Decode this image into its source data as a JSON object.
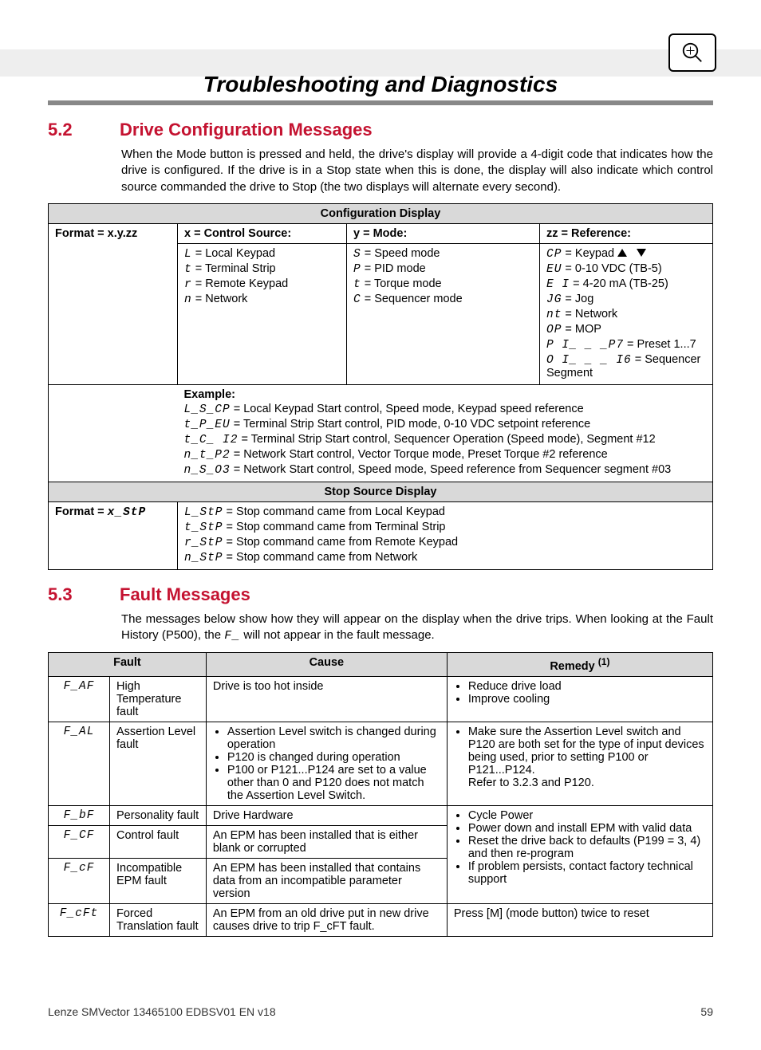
{
  "title": "Troubleshooting and Diagnostics",
  "sec52_num": "5.2",
  "sec52_title": "Drive Configuration Messages",
  "sec52_intro": "When the Mode button is pressed and held, the drive's display will provide a 4-digit code that indicates how the drive is configured. If the drive is in a Stop state when this is done, the display will also indicate which control source commanded the drive to Stop (the two displays will alternate every second).",
  "cfg_header": "Configuration Display",
  "cfg_format_lbl": "Format = x.y.zz",
  "cfg_x_hdr": "x = Control Source:",
  "cfg_y_hdr": "y = Mode:",
  "cfg_zz_hdr": "zz = Reference:",
  "x_L": "L",
  "x_L_txt": " = Local Keypad",
  "x_t": "t",
  "x_t_txt": " = Terminal Strip",
  "x_r": "r",
  "x_r_txt": " = Remote Keypad",
  "x_n": "n",
  "x_n_txt": " = Network",
  "y_S": "S",
  "y_S_txt": " = Speed mode",
  "y_P": "P",
  "y_P_txt": " = PID mode",
  "y_t": "t",
  "y_t_txt": " = Torque mode",
  "y_C": "C",
  "y_C_txt": " = Sequencer mode",
  "z_CP": "CP",
  "z_CP_txt": " = Keypad ",
  "z_EU": "EU",
  "z_EU_txt": " = 0-10 VDC (TB-5)",
  "z_EI": "E I",
  "z_EI_txt": " = 4-20 mA (TB-25)",
  "z_JG": "JG",
  "z_JG_txt": " = Jog",
  "z_nt": "nt",
  "z_nt_txt": " = Network",
  "z_OP": "OP",
  "z_OP_txt": " = MOP",
  "z_P1": "P I_ _ _P7",
  "z_P1_txt": " = Preset 1...7",
  "z_O1": "O I_ _ _  I6",
  "z_O1_txt": " = Sequencer Segment",
  "ex_hdr": "Example:",
  "ex1_c": "L_S_CP",
  "ex1_t": " = Local Keypad Start control, Speed mode, Keypad speed reference",
  "ex2_c": "t_P_EU",
  "ex2_t": " = Terminal Strip Start control, PID mode, 0-10 VDC setpoint reference",
  "ex3_c": "t_C_ I2",
  "ex3_t": " = Terminal Strip Start control, Sequencer Operation (Speed mode), Segment #12",
  "ex4_c": "n_t_P2",
  "ex4_t": " = Network Start control, Vector Torque mode, Preset Torque #2 reference",
  "ex5_c": "n_S_O3",
  "ex5_t": " = Network Start control, Speed mode, Speed reference from Sequencer segment #03",
  "stop_header": "Stop Source Display",
  "stop_format": "Format = x_StP",
  "stp1_c": "L_StP",
  "stp1_t": " = Stop command came from Local Keypad",
  "stp2_c": "t_StP",
  "stp2_t": " = Stop command came from Terminal Strip",
  "stp3_c": "r_StP",
  "stp3_t": " = Stop command came from Remote Keypad",
  "stp4_c": "n_StP",
  "stp4_t": " = Stop command came from Network",
  "sec53_num": "5.3",
  "sec53_title": "Fault Messages",
  "sec53_intro_a": "The messages below show how they will appear on the display when the drive trips. When looking at the Fault History (P500), the ",
  "sec53_intro_code": "F_",
  "sec53_intro_b": " will not appear in the fault message.",
  "flt_h_fault": "Fault",
  "flt_h_cause": "Cause",
  "flt_h_remedy": "Remedy ",
  "flt_h_remedy_sup": "(1)",
  "r1_code": "F_AF",
  "r1_name": "High Temperature fault",
  "r1_cause": "Drive is too hot inside",
  "r1_rem1": "Reduce drive load",
  "r1_rem2": "Improve cooling",
  "r2_code": "F_AL",
  "r2_name": "Assertion Level fault",
  "r2_c1": "Assertion Level switch is changed during operation",
  "r2_c2": "P120 is changed during operation",
  "r2_c3": "P100 or P121...P124 are set to a value other than 0 and P120 does not match the Assertion Level Switch.",
  "r2_rem1": "Make sure the Assertion Level switch and P120 are both set for the type of input devices being used, prior to setting P100 or P121...P124.",
  "r2_rem2": "Refer to 3.2.3 and P120.",
  "r3_code": "F_bF",
  "r3_name": "Personality fault",
  "r3_cause": "Drive Hardware",
  "r4_code": "F_CF",
  "r4_name": "Control fault",
  "r4_cause": "An EPM has been installed that is either blank or corrupted",
  "r5_code": "F_cF",
  "r5_name": "Incompatible EPM fault",
  "r5_cause": "An EPM has been installed that contains data from an incompatible parameter version",
  "rshared_1": "Cycle Power",
  "rshared_2": "Power down and install EPM with valid data",
  "rshared_3": "Reset the drive back to defaults (P199 = 3, 4) and then re-program",
  "rshared_4": "If problem persists, contact factory technical support",
  "r6_code": "F_cFt",
  "r6_name": "Forced Translation fault",
  "r6_cause": "An EPM from an old drive put in new drive causes drive to trip F_cFT fault.",
  "r6_rem": "Press [M] (mode button) twice to reset",
  "footer_left": "Lenze SMVector 13465100 EDBSV01 EN v18",
  "footer_right": "59"
}
